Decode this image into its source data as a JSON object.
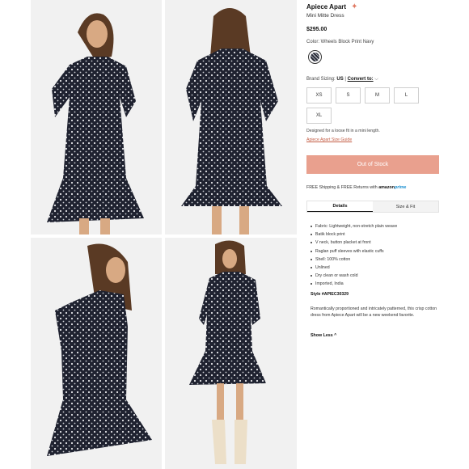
{
  "product": {
    "brand": "Apiece Apart",
    "name": "Mini Mitte Dress",
    "price": "$295.00",
    "color_label": "Color: Wheels Block Print Navy",
    "sizing_label": "Brand Sizing:",
    "sizing_region": "US",
    "convert_label": "Convert to:",
    "sizes": [
      "XS",
      "S",
      "M",
      "L",
      "XL"
    ],
    "fit_note": "Designed for a loose fit in a mini length.",
    "size_guide": "Apiece Apart Size Guide",
    "stock_button": "Out of Stock",
    "shipping_text": "FREE Shipping & FREE Returns with",
    "shipping_amazon": "amazon",
    "shipping_prime": "prime"
  },
  "tabs": [
    "Details",
    "Size & Fit"
  ],
  "details": [
    "Fabric: Lightweight, non-stretch plain weave",
    "Batik block print",
    "V neck, button placket at front",
    "Raglan puff sleeves with elastic cuffs",
    "Shell: 100% cotton",
    "Unlined",
    "Dry clean or wash cold",
    "Imported, India"
  ],
  "style_number": "Style #APIEC30329",
  "description": "Romantically proportioned and intricately patterned, this crisp cotton dress from Apiece Apart will be a new weekend favorite.",
  "show_less": "Show Less",
  "colors": {
    "accent": "#e9a08e",
    "link": "#c45d45",
    "dress": "#1f2230"
  }
}
